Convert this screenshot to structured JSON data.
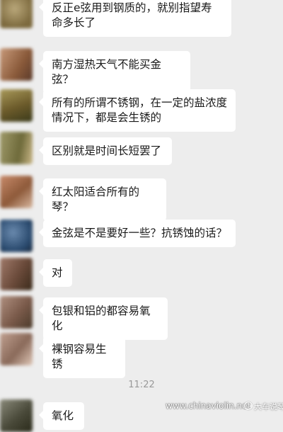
{
  "messages": [
    {
      "text": "反正e弦用到钢质的，就别指望寿命多长了"
    },
    {
      "text": "南方湿热天气不能买金弦？"
    },
    {
      "text": "所有的所谓不锈钢，在一定的盐浓度情况下，都是会生锈的"
    },
    {
      "text": "区别就是时间长短罢了"
    },
    {
      "text": "红太阳适合所有的琴？"
    },
    {
      "text": "金弦是不是要好一些？抗锈蚀的话？"
    },
    {
      "text": "对"
    },
    {
      "text": "包银和铝的都容易氧化"
    },
    {
      "text": "裸钢容易生锈"
    },
    {
      "text": "氧化"
    }
  ],
  "timestamp": "11:22",
  "watermark": {
    "site": "www.chinaviolin.net",
    "account": "大车说琴"
  },
  "avatar_colors": [
    [
      "#7d6a3e",
      "#b9a77a"
    ],
    [
      "#8a5a3a",
      "#c89a7a"
    ],
    [
      "#6b5a2a",
      "#a99a5a"
    ],
    [
      "#6e6a3a",
      "#9f9a6a"
    ],
    [
      "#8e5a3a",
      "#c88a6a"
    ],
    [
      "#2a4a6e",
      "#6a8aae"
    ],
    [
      "#6a4a3a",
      "#a07a6a"
    ],
    [
      "#7a5a4a",
      "#b09080"
    ],
    [
      "#8a6a5a",
      "#c0a090"
    ],
    [
      "#4a4a3a",
      "#8a8a7a"
    ]
  ]
}
